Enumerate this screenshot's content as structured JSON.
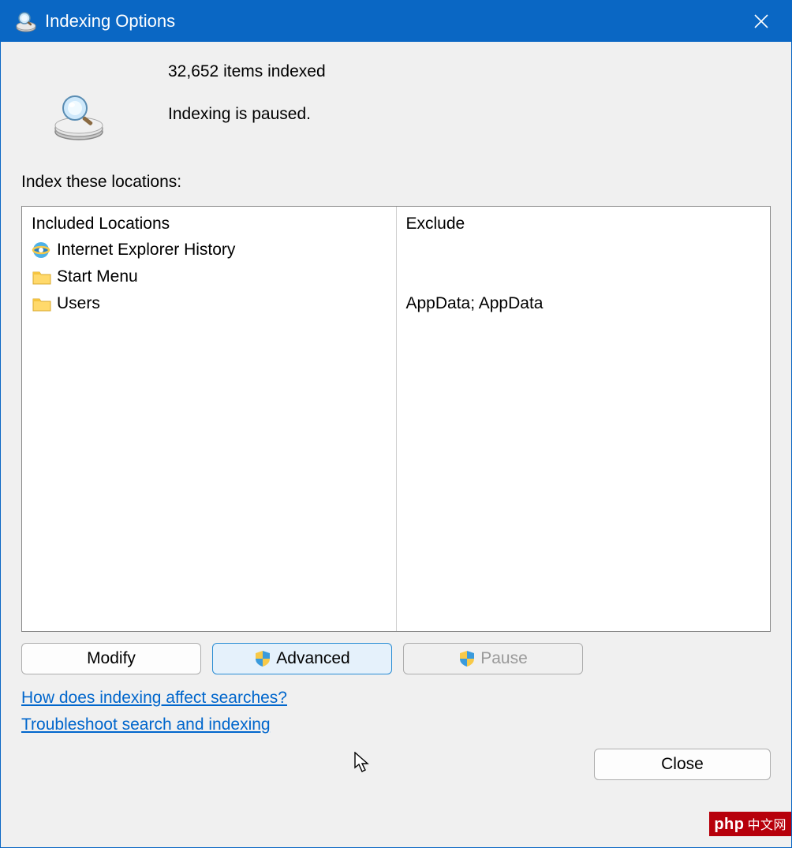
{
  "window": {
    "title": "Indexing Options"
  },
  "status": {
    "count_line": "32,652 items indexed",
    "state_line": "Indexing is paused."
  },
  "section_label": "Index these locations:",
  "columns": {
    "included_header": "Included Locations",
    "exclude_header": "Exclude"
  },
  "locations": [
    {
      "icon": "ie-icon",
      "name": "Internet Explorer History",
      "exclude": ""
    },
    {
      "icon": "folder-icon",
      "name": "Start Menu",
      "exclude": ""
    },
    {
      "icon": "folder-icon",
      "name": "Users",
      "exclude": "AppData; AppData"
    }
  ],
  "buttons": {
    "modify": "Modify",
    "advanced": "Advanced",
    "pause": "Pause",
    "close": "Close"
  },
  "links": {
    "help": "How does indexing affect searches?",
    "troubleshoot": "Troubleshoot search and indexing"
  },
  "watermark": {
    "text": "php",
    "cn": "中文网"
  }
}
